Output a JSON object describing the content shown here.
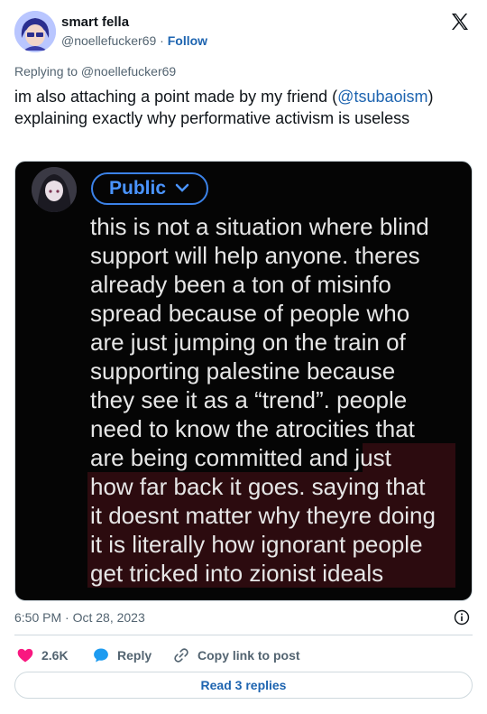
{
  "author": {
    "name": "smart fella",
    "handle": "@noellefucker69",
    "separator": "·",
    "follow_label": "Follow"
  },
  "reply_to": "Replying to @noellefucker69",
  "tweet": {
    "text_before": "im also attaching a point made by my friend (",
    "mention": "@tsubaoism",
    "text_after": ") explaining exactly why performative activism is useless"
  },
  "media": {
    "visibility_label": "Public",
    "lines": [
      "this is not a situation where blind",
      "support will help anyone. theres",
      "already been a ton of misinfo",
      "spread because of people who",
      "are just jumping on the train of",
      "supporting palestine because",
      "they see it as a “trend”. people",
      "need to know the atrocities that",
      "are being committed and just",
      "how far back it goes. saying that",
      "it doesnt matter why theyre doing",
      "it is literally how ignorant people",
      "get tricked into zionist ideals"
    ]
  },
  "timestamp": "6:50 PM · Oct 28, 2023",
  "actions": {
    "likes": "2.6K",
    "reply_label": "Reply",
    "copy_label": "Copy link to post"
  },
  "read_replies_label": "Read 3 replies",
  "icons": [
    "heart-icon",
    "reply-bubble-icon",
    "link-icon",
    "info-icon",
    "x-logo-icon",
    "chevron-down-icon"
  ],
  "colors": {
    "accent": "#1d64b0",
    "heart": "#f91880",
    "public_pill": "#3b82e8"
  }
}
